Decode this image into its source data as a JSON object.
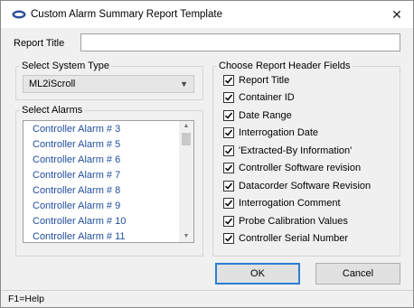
{
  "window": {
    "title": "Custom Alarm Summary Report Template",
    "close_glyph": "✕"
  },
  "report_title": {
    "label": "Report Title",
    "value": ""
  },
  "system_type": {
    "group_label": "Select System Type",
    "selected": "ML2iScroll"
  },
  "alarms": {
    "group_label": "Select Alarms",
    "items": [
      "Controller Alarm # 3",
      "Controller Alarm # 5",
      "Controller Alarm # 6",
      "Controller Alarm # 7",
      "Controller Alarm # 8",
      "Controller Alarm # 9",
      "Controller Alarm # 10",
      "Controller Alarm # 11"
    ]
  },
  "header_fields": {
    "group_label": "Choose Report Header Fields",
    "items": [
      {
        "label": "Report Title",
        "checked": true
      },
      {
        "label": "Container ID",
        "checked": true
      },
      {
        "label": "Date Range",
        "checked": true
      },
      {
        "label": "Interrogation Date",
        "checked": true
      },
      {
        "label": "'Extracted-By Information'",
        "checked": true
      },
      {
        "label": "Controller Software revision",
        "checked": true
      },
      {
        "label": "Datacorder Software Revision",
        "checked": true
      },
      {
        "label": "Interrogation Comment",
        "checked": true
      },
      {
        "label": "Probe Calibration Values",
        "checked": true
      },
      {
        "label": "Controller Serial Number",
        "checked": true
      }
    ]
  },
  "buttons": {
    "ok": "OK",
    "cancel": "Cancel"
  },
  "status": {
    "help": "F1=Help"
  }
}
